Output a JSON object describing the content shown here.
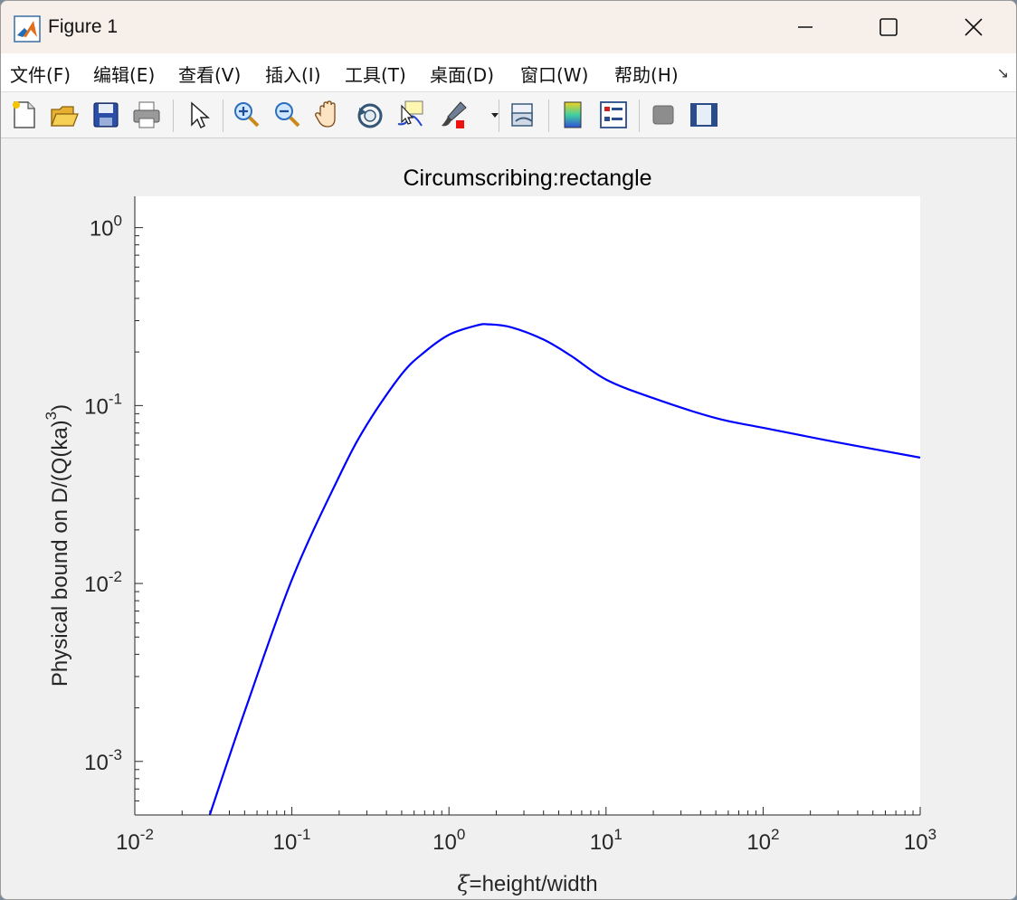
{
  "window": {
    "title": "Figure 1",
    "controls": [
      "minimize-icon",
      "maximize-icon",
      "close-icon"
    ]
  },
  "menu": {
    "items": [
      {
        "label": "文件(F)",
        "key": "F"
      },
      {
        "label": "编辑(E)",
        "key": "E"
      },
      {
        "label": "查看(V)",
        "key": "V"
      },
      {
        "label": "插入(I)",
        "key": "I"
      },
      {
        "label": "工具(T)",
        "key": "T"
      },
      {
        "label": "桌面(D)",
        "key": "D"
      },
      {
        "label": "窗口(W)",
        "key": "W"
      },
      {
        "label": "帮助(H)",
        "key": "H"
      }
    ],
    "corner_icon": "dock-arrow-icon"
  },
  "toolbar": {
    "icons": [
      "new-figure-icon",
      "open-file-icon",
      "save-icon",
      "print-icon",
      "pointer-icon",
      "zoom-in-icon",
      "zoom-out-icon",
      "pan-icon",
      "rotate-3d-icon",
      "data-cursor-icon",
      "brush-icon",
      "link-plot-icon",
      "colorbar-icon",
      "legend-icon",
      "hide-plot-tools-icon",
      "show-plot-tools-icon"
    ]
  },
  "chart_data": {
    "type": "line",
    "title": "Circumscribing:rectangle",
    "xlabel": "ξ=height/width",
    "ylabel": "Physical bound on D/(Q(ka)³)",
    "xscale": "log",
    "yscale": "log",
    "xlim": [
      0.01,
      1000
    ],
    "ylim": [
      0.0005,
      1.5
    ],
    "xticks": [
      "10^-2",
      "10^-1",
      "10^0",
      "10^1",
      "10^2",
      "10^3"
    ],
    "yticks": [
      "10^-3",
      "10^-2",
      "10^-1",
      "10^0"
    ],
    "grid": false,
    "series": [
      {
        "color": "#0000ff",
        "x": [
          0.03,
          0.05,
          0.1,
          0.2,
          0.3,
          0.5,
          0.7,
          1.0,
          1.5,
          1.8,
          2.5,
          4,
          6,
          10,
          20,
          50,
          100,
          300,
          1000
        ],
        "y": [
          0.0005,
          0.0019,
          0.0105,
          0.04,
          0.078,
          0.15,
          0.2,
          0.25,
          0.282,
          0.286,
          0.275,
          0.235,
          0.19,
          0.14,
          0.11,
          0.085,
          0.075,
          0.062,
          0.051
        ]
      }
    ]
  }
}
